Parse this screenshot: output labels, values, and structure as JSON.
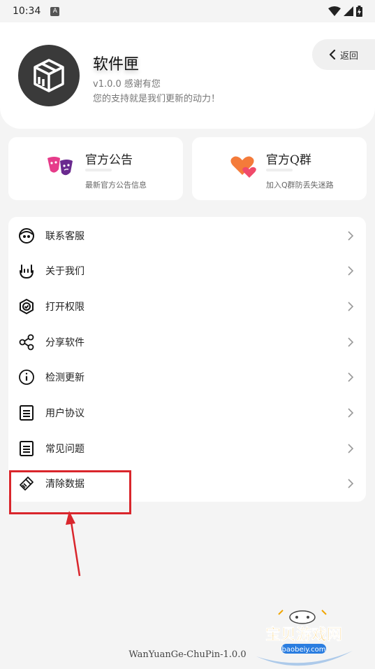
{
  "status_bar": {
    "time": "10:34",
    "notif_glyph": "A"
  },
  "header": {
    "app_name": "软件匣",
    "version_line": "v1.0.0 感谢有您",
    "slogan": "您的支持就是我们更新的动力！",
    "back_label": "返回"
  },
  "quick_cards": [
    {
      "title": "官方公告",
      "subtitle": "最新官方公告信息",
      "icon": "theater-masks-icon"
    },
    {
      "title": "官方Q群",
      "subtitle": "加入Q群防丢失迷路",
      "icon": "hearts-icon"
    }
  ],
  "menu": [
    {
      "label": "联系客服",
      "icon": "face-icon"
    },
    {
      "label": "关于我们",
      "icon": "rock-hand-icon"
    },
    {
      "label": "打开权限",
      "icon": "shield-check-icon"
    },
    {
      "label": "分享软件",
      "icon": "share-icon"
    },
    {
      "label": "检测更新",
      "icon": "info-icon"
    },
    {
      "label": "用户协议",
      "icon": "document-icon"
    },
    {
      "label": "常见问题",
      "icon": "document-icon"
    },
    {
      "label": "清除数据",
      "icon": "broom-icon"
    }
  ],
  "footer": {
    "build": "WanYuanGe-ChuPin-1.0.0"
  },
  "watermark": {
    "title": "宝贝游戏网",
    "url": "baobeiy.com"
  },
  "colors": {
    "highlight": "#d9262c",
    "avatar_bg": "#3a3a3a",
    "background": "#f4f4f4"
  }
}
